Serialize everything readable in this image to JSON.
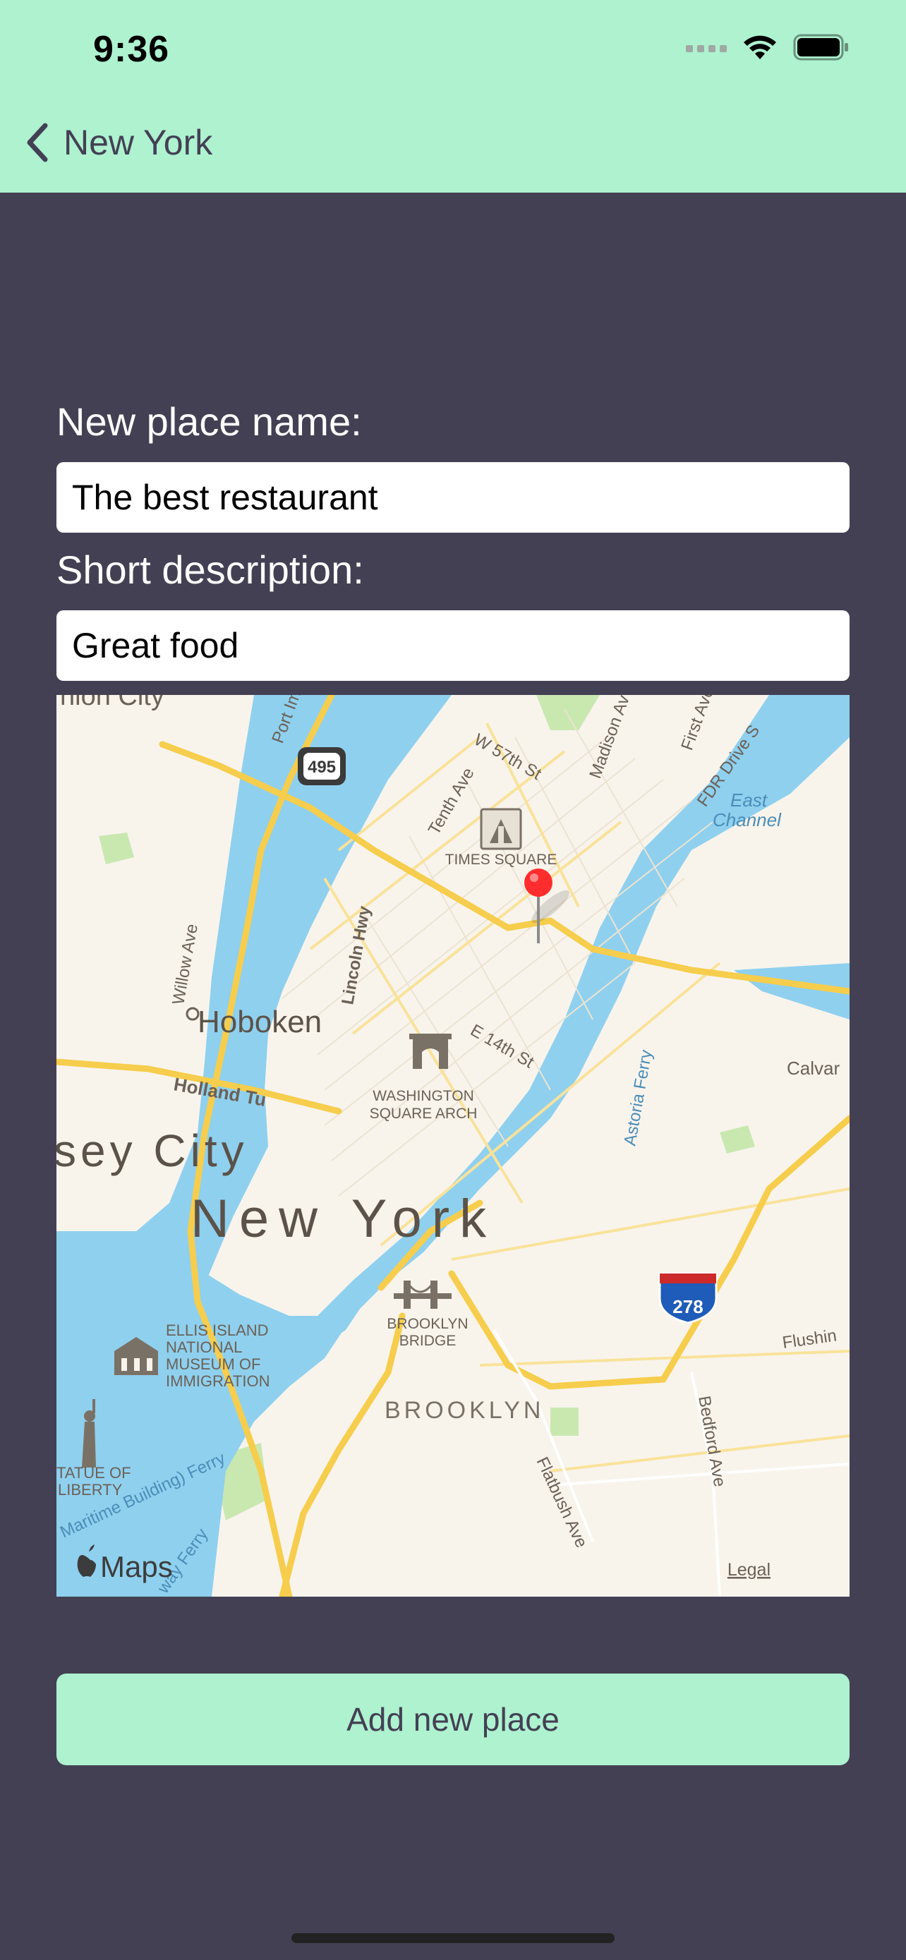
{
  "status_bar": {
    "time": "9:36"
  },
  "nav": {
    "back_label": "New York"
  },
  "form": {
    "name_label": "New place name:",
    "name_value": "The best restaurant",
    "description_label": "Short description:",
    "description_value": "Great food"
  },
  "map": {
    "labels": {
      "union_city": "nion City",
      "w57": "W 57th St",
      "madison": "Madison Av",
      "first_ave": "First Ave",
      "fdr": "FDR Drive S",
      "east_channel_1": "East",
      "east_channel_2": "Channel",
      "port_imperial": "Port Im",
      "hwy_495": "495",
      "tenth_ave": "Tenth Ave",
      "times_square": "TIMES SQUARE",
      "willow_ave": "Willow Ave",
      "lincoln_hwy": "Lincoln Hwy",
      "hoboken": "Hoboken",
      "e14": "E 14th St",
      "astoria_ferry": "Astoria Ferry",
      "calvary": "Calvar",
      "holland": "Holland Tu",
      "washington_1": "WASHINGTON",
      "washington_2": "SQUARE ARCH",
      "jersey_city": "sey City",
      "new_york": "New York",
      "i278": "278",
      "ellis_1": "ELLIS ISLAND",
      "ellis_2": "NATIONAL",
      "ellis_3": "MUSEUM OF",
      "ellis_4": "IMMIGRATION",
      "brooklyn_bridge_1": "BROOKLYN",
      "brooklyn_bridge_2": "BRIDGE",
      "flushing": "Flushin",
      "brooklyn": "BROOKLYN",
      "bedford": "Bedford Ave",
      "statue_1": "TATUE OF",
      "statue_2": "LIBERTY",
      "maritime": "Maritime Building) Ferry",
      "flatbush": "Flatbush Ave",
      "ferry": "way Ferry",
      "maps": "Maps",
      "legal": "Legal"
    }
  },
  "action": {
    "add_label": "Add new place"
  },
  "colors": {
    "header_bg": "#aef2d0",
    "page_bg": "#444054",
    "button_bg": "#aef2d0",
    "water": "#8fd0ee",
    "highway": "#f6cd4c",
    "land": "#f8f4ec",
    "pin": "#ff2d2d"
  }
}
